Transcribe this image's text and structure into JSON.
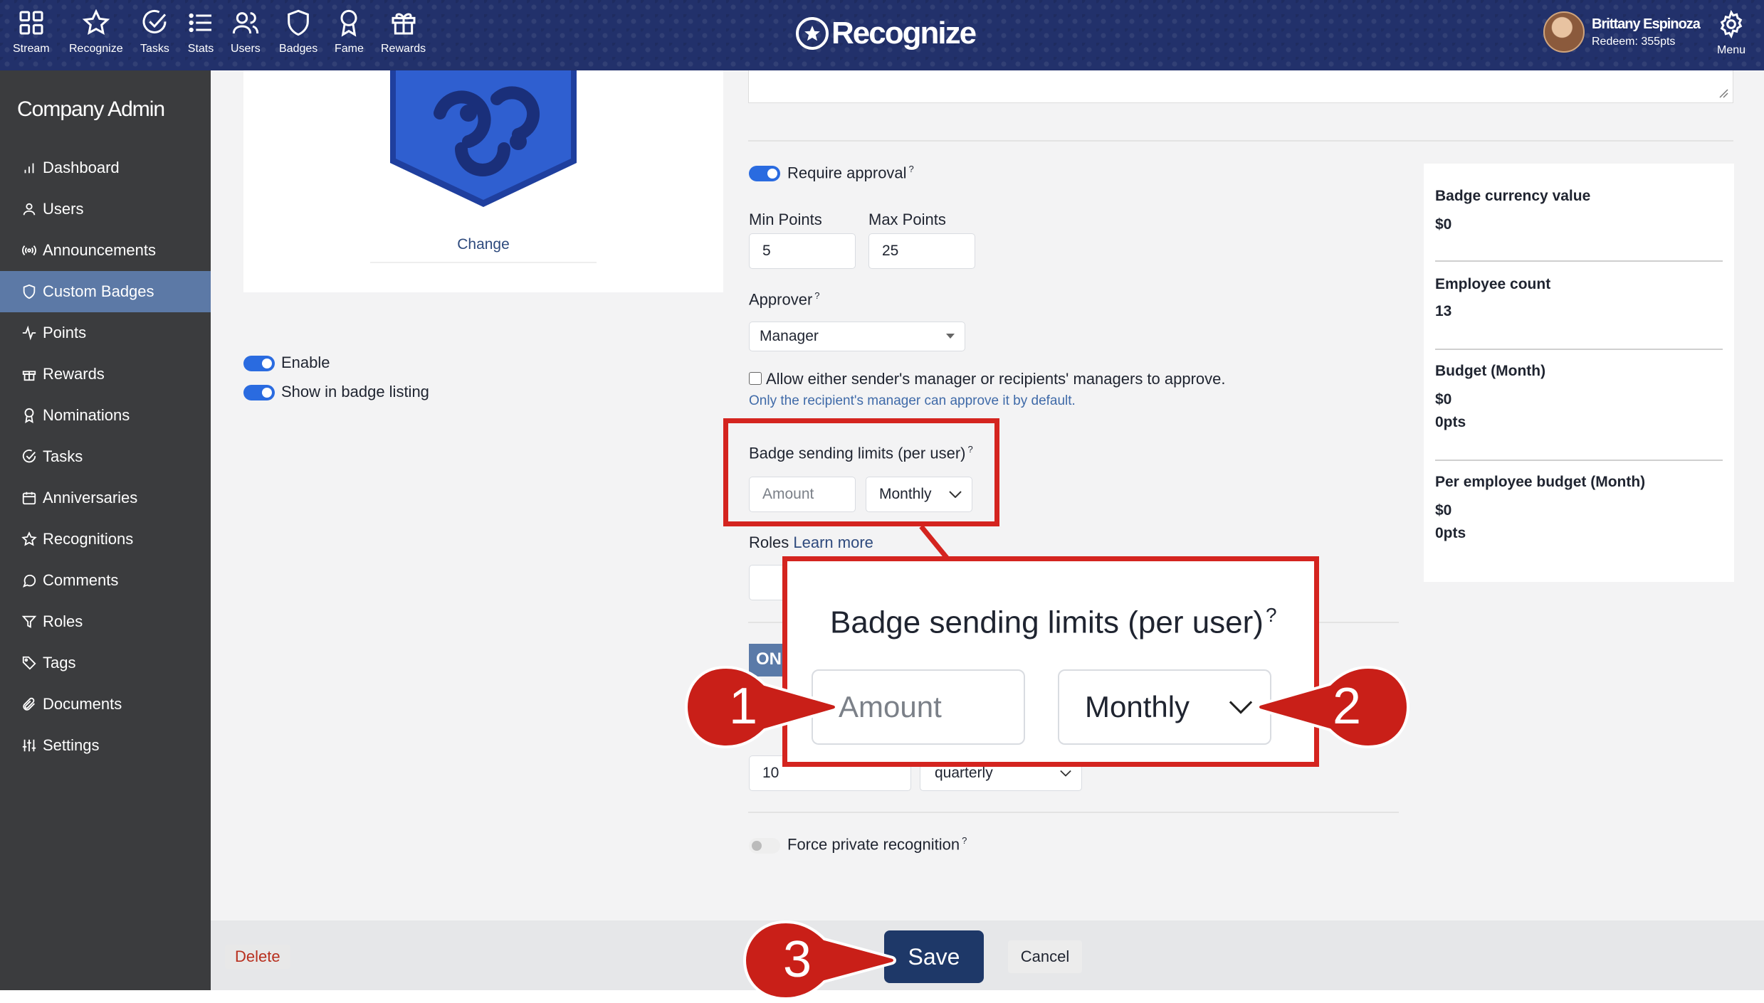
{
  "topnav": {
    "items": [
      {
        "label": "Stream",
        "icon": "grid-icon"
      },
      {
        "label": "Recognize",
        "icon": "star-icon"
      },
      {
        "label": "Tasks",
        "icon": "check-circle-icon"
      },
      {
        "label": "Stats",
        "icon": "list-icon"
      },
      {
        "label": "Users",
        "icon": "users-icon"
      },
      {
        "label": "Badges",
        "icon": "shield-icon"
      },
      {
        "label": "Fame",
        "icon": "ribbon-icon"
      },
      {
        "label": "Rewards",
        "icon": "gift-icon"
      }
    ],
    "logo_text": "Recognize",
    "user_name": "Brittany Espinoza",
    "user_points": "Redeem: 355pts",
    "menu_label": "Menu"
  },
  "sidebar": {
    "title": "Company Admin",
    "items": [
      {
        "label": "Dashboard",
        "icon": "bar-chart-icon"
      },
      {
        "label": "Users",
        "icon": "user-icon"
      },
      {
        "label": "Announcements",
        "icon": "broadcast-icon"
      },
      {
        "label": "Custom Badges",
        "icon": "shield-icon",
        "active": true
      },
      {
        "label": "Points",
        "icon": "pulse-icon"
      },
      {
        "label": "Rewards",
        "icon": "gift-icon"
      },
      {
        "label": "Nominations",
        "icon": "ribbon-icon"
      },
      {
        "label": "Tasks",
        "icon": "check-circle-icon"
      },
      {
        "label": "Anniversaries",
        "icon": "calendar-icon"
      },
      {
        "label": "Recognitions",
        "icon": "star-icon"
      },
      {
        "label": "Comments",
        "icon": "comment-icon"
      },
      {
        "label": "Roles",
        "icon": "filter-icon"
      },
      {
        "label": "Tags",
        "icon": "tag-icon"
      },
      {
        "label": "Documents",
        "icon": "paperclip-icon"
      },
      {
        "label": "Settings",
        "icon": "sliders-icon"
      }
    ]
  },
  "badge_panel": {
    "change_label": "Change",
    "enable_label": "Enable",
    "show_listing_label": "Show in badge listing"
  },
  "form": {
    "require_approval_label": "Require approval",
    "help_mark": "?",
    "min_points_label": "Min Points",
    "min_points_value": "5",
    "max_points_label": "Max Points",
    "max_points_value": "25",
    "approver_label": "Approver",
    "approver_value": "Manager",
    "allow_managers_label": "Allow either sender's manager or recipients' managers to approve.",
    "allow_managers_help": "Only the recipient's manager can approve it by default.",
    "sending_limits_label": "Badge sending limits (per user)",
    "amount_placeholder": "Amount",
    "period_value": "Monthly",
    "roles_label": "Roles",
    "roles_link": "Learn more",
    "on_tag": "ON",
    "limit_value": "10",
    "limit_period": "quarterly",
    "force_private_label": "Force private recognition"
  },
  "stats": {
    "currency_title": "Badge currency value",
    "currency_value": "$0",
    "employee_title": "Employee count",
    "employee_value": "13",
    "budget_title": "Budget (Month)",
    "budget_value": "$0",
    "budget_pts": "0pts",
    "per_employee_title": "Per employee budget (Month)",
    "per_employee_value": "$0",
    "per_employee_pts": "0pts"
  },
  "actions": {
    "delete_label": "Delete",
    "save_label": "Save",
    "cancel_label": "Cancel"
  },
  "annotations": {
    "zoom_title": "Badge sending limits (per user)",
    "zoom_amount": "Amount",
    "zoom_period": "Monthly",
    "callout_1": "1",
    "callout_2": "2",
    "callout_3": "3",
    "accent_color": "#d4241f"
  },
  "colors": {
    "topbar": "#22316b",
    "sidebar": "#3b3c3e",
    "sidebar_active": "#5c79a6",
    "primary_button": "#1e3868",
    "toggle_on": "#2a6be0",
    "badge_blue": "#2f5fd0"
  }
}
